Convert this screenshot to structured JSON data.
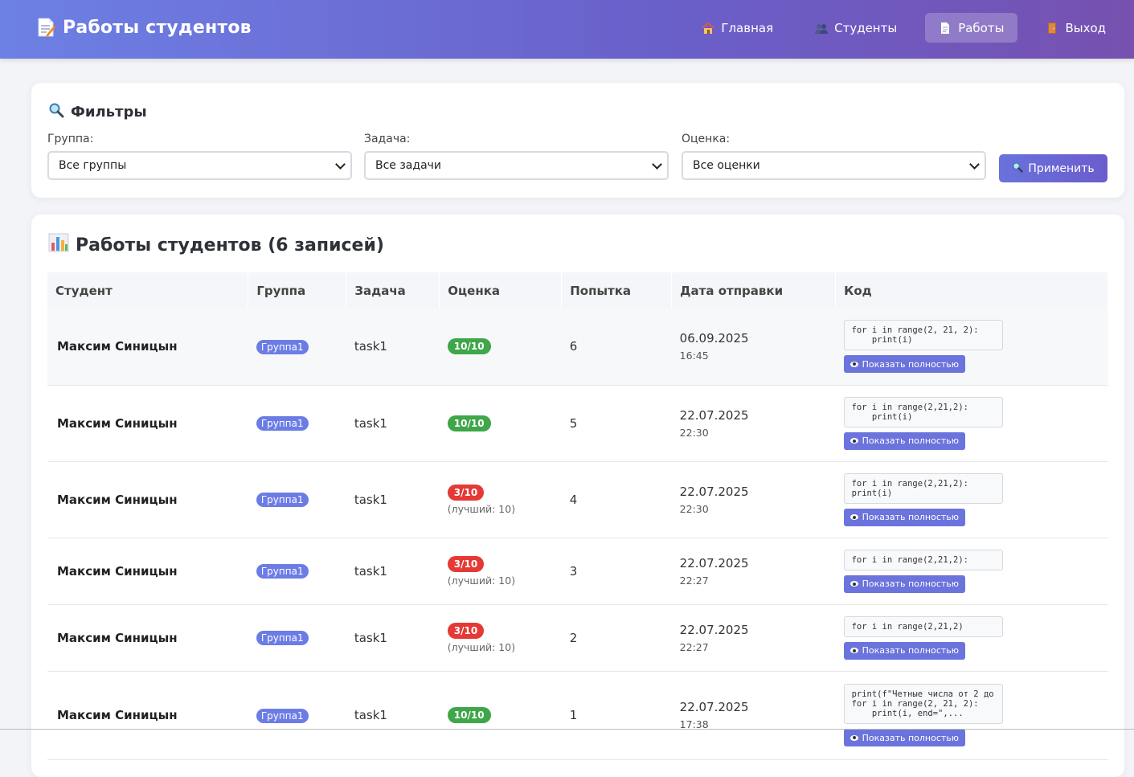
{
  "header": {
    "title": "Работы студентов",
    "nav": [
      {
        "label": "Главная",
        "icon": "house-icon"
      },
      {
        "label": "Студенты",
        "icon": "people-icon"
      },
      {
        "label": "Работы",
        "icon": "document-icon",
        "active": true
      },
      {
        "label": "Выход",
        "icon": "door-icon"
      }
    ]
  },
  "filters": {
    "title": "Фильтры",
    "group": {
      "label": "Группа:",
      "value": "Все группы"
    },
    "task": {
      "label": "Задача:",
      "value": "Все задачи"
    },
    "grade": {
      "label": "Оценка:",
      "value": "Все оценки"
    },
    "apply_label": "Применить"
  },
  "works": {
    "title": "Работы студентов (6 записей)",
    "columns": [
      "Студент",
      "Группа",
      "Задача",
      "Оценка",
      "Попытка",
      "Дата отправки",
      "Код"
    ],
    "show_label": "Показать полностью",
    "rows": [
      {
        "student": "Максим Синицын",
        "group": "Группа1",
        "task": "task1",
        "grade": "10/10",
        "status": "ok",
        "best": "",
        "attempt": "6",
        "date": "06.09.2025",
        "time": "16:45",
        "code": "for i in range(2, 21, 2):\n    print(i)"
      },
      {
        "student": "Максим Синицын",
        "group": "Группа1",
        "task": "task1",
        "grade": "10/10",
        "status": "ok",
        "best": "",
        "attempt": "5",
        "date": "22.07.2025",
        "time": "22:30",
        "code": "for i in range(2,21,2):\n    print(i)"
      },
      {
        "student": "Максим Синицын",
        "group": "Группа1",
        "task": "task1",
        "grade": "3/10",
        "status": "bad",
        "best": "(лучший: 10)",
        "attempt": "4",
        "date": "22.07.2025",
        "time": "22:30",
        "code": "for i in range(2,21,2):\nprint(i)"
      },
      {
        "student": "Максим Синицын",
        "group": "Группа1",
        "task": "task1",
        "grade": "3/10",
        "status": "bad",
        "best": "(лучший: 10)",
        "attempt": "3",
        "date": "22.07.2025",
        "time": "22:27",
        "code": "for i in range(2,21,2):"
      },
      {
        "student": "Максим Синицын",
        "group": "Группа1",
        "task": "task1",
        "grade": "3/10",
        "status": "bad",
        "best": "(лучший: 10)",
        "attempt": "2",
        "date": "22.07.2025",
        "time": "22:27",
        "code": "for i in range(2,21,2)"
      },
      {
        "student": "Максим Синицын",
        "group": "Группа1",
        "task": "task1",
        "grade": "10/10",
        "status": "ok",
        "best": "",
        "attempt": "1",
        "date": "22.07.2025",
        "time": "17:38",
        "code": "print(f\"Четные числа от 2 до\nfor i in range(2, 21, 2):\n    print(i, end=\",..."
      }
    ]
  },
  "colors": {
    "accent": "#6b74dc",
    "success": "#3fa64a",
    "danger": "#e53935",
    "header_start": "#6d80e4",
    "header_end": "#7651b0"
  }
}
